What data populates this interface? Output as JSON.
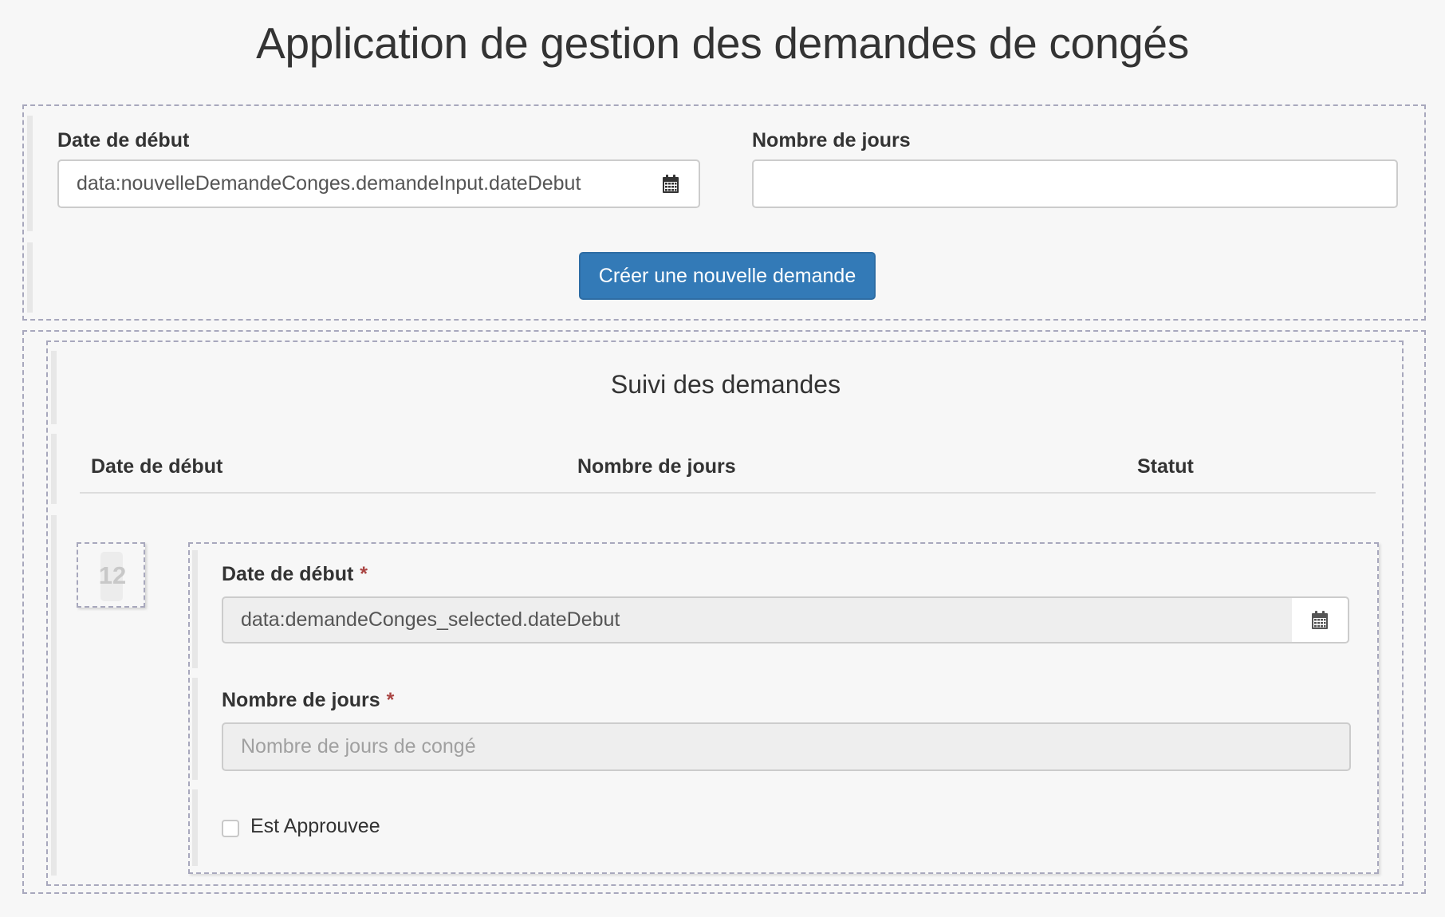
{
  "app": {
    "title": "Application de gestion des demandes de congés"
  },
  "new_request": {
    "date_label": "Date de début",
    "date_value": "data:nouvelleDemandeConges.demandeInput.dateDebut",
    "days_label": "Nombre de jours",
    "days_value": "",
    "create_button": "Créer une nouvelle demande"
  },
  "tracking": {
    "title": "Suivi des demandes",
    "columns": [
      "Date de début",
      "Nombre de jours",
      "Statut"
    ],
    "row": {
      "id": "12",
      "date_label": "Date de début",
      "required_mark": "*",
      "date_value": "data:demandeConges_selected.dateDebut",
      "days_label": "Nombre de jours",
      "days_placeholder": "Nombre de jours de congé",
      "approved_label": "Est Approuvee",
      "approved": false
    }
  },
  "icons": {
    "calendar": "calendar-icon",
    "checkbox": "checkbox-icon"
  },
  "colors": {
    "primary": "#337ab7",
    "required": "#a94442",
    "dashed_border": "#a8a8bd",
    "readonly_bg": "#eeeeee"
  }
}
